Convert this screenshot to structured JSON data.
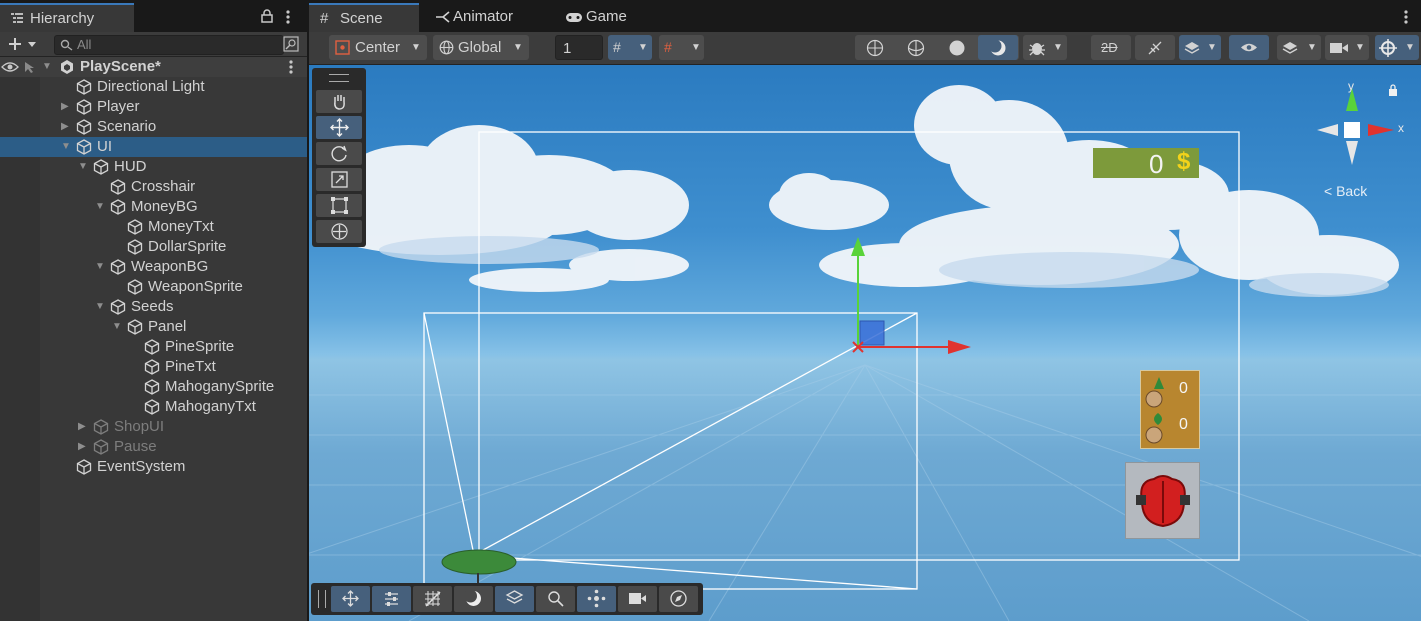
{
  "hierarchy": {
    "tab_label": "Hierarchy",
    "search_placeholder": "All",
    "scene_name": "PlayScene*",
    "items": [
      {
        "label": "Directional Light",
        "depth": 1,
        "arrow": ""
      },
      {
        "label": "Player",
        "depth": 1,
        "arrow": "▶"
      },
      {
        "label": "Scenario",
        "depth": 1,
        "arrow": "▶"
      },
      {
        "label": "UI",
        "depth": 1,
        "arrow": "▼",
        "selected": true
      },
      {
        "label": "HUD",
        "depth": 2,
        "arrow": "▼"
      },
      {
        "label": "Crosshair",
        "depth": 3,
        "arrow": ""
      },
      {
        "label": "MoneyBG",
        "depth": 3,
        "arrow": "▼"
      },
      {
        "label": "MoneyTxt",
        "depth": 4,
        "arrow": ""
      },
      {
        "label": "DollarSprite",
        "depth": 4,
        "arrow": ""
      },
      {
        "label": "WeaponBG",
        "depth": 3,
        "arrow": "▼"
      },
      {
        "label": "WeaponSprite",
        "depth": 4,
        "arrow": ""
      },
      {
        "label": "Seeds",
        "depth": 3,
        "arrow": "▼"
      },
      {
        "label": "Panel",
        "depth": 4,
        "arrow": "▼"
      },
      {
        "label": "PineSprite",
        "depth": 5,
        "arrow": ""
      },
      {
        "label": "PineTxt",
        "depth": 5,
        "arrow": ""
      },
      {
        "label": "MahoganySprite",
        "depth": 5,
        "arrow": ""
      },
      {
        "label": "MahoganyTxt",
        "depth": 5,
        "arrow": ""
      },
      {
        "label": "ShopUI",
        "depth": 2,
        "arrow": "▶",
        "dim": true
      },
      {
        "label": "Pause",
        "depth": 2,
        "arrow": "▶",
        "dim": true
      },
      {
        "label": "EventSystem",
        "depth": 1,
        "arrow": ""
      }
    ]
  },
  "scene": {
    "tabs": [
      {
        "label": "Scene",
        "icon": "grid-icon",
        "active": true
      },
      {
        "label": "Animator",
        "icon": "animator-icon",
        "active": false
      },
      {
        "label": "Game",
        "icon": "gamepad-icon",
        "active": false
      }
    ],
    "pivot_mode": "Center",
    "pivot_rotation": "Global",
    "grid_snap_value": "1",
    "gizmo_back_label": "< Back",
    "gizmo_x_label": "x",
    "gizmo_y_label": "y",
    "hud": {
      "money_value": "0",
      "pine_count": "0",
      "mahogany_count": "0"
    },
    "colors": {
      "accent": "#3a79bb",
      "selection": "#2c5d87",
      "money_bg": "#7d9a3b",
      "seeds_bg": "#b8862f",
      "x_axis": "#e0332f",
      "y_axis": "#59d33a"
    }
  }
}
